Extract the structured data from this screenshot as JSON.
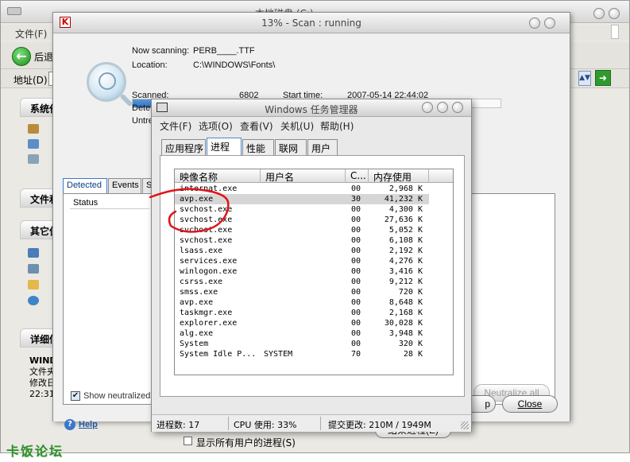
{
  "explorer": {
    "title": "本地磁盘 (C:)",
    "menu_file": "文件(F)",
    "back_label": "后退",
    "address_label": "地址(D)",
    "task_groups": [
      {
        "label": "系统任务"
      },
      {
        "label": "文件和"
      },
      {
        "label": "其它位"
      },
      {
        "label": "详细信"
      }
    ],
    "details_lines": [
      "WIND",
      "文件夹",
      "修改日",
      "22:31"
    ]
  },
  "scan": {
    "title": "13% - Scan : running",
    "now_scanning_label": "Now scanning:",
    "now_scanning_value": "PERB____.TTF",
    "location_label": "Location:",
    "location_value": "C:\\WINDOWS\\Fonts\\",
    "progress_percent": 13,
    "scanned_label": "Scanned:",
    "scanned_value": "6802",
    "start_time_label": "Start time:",
    "start_time_value": "2007-05-14 22:44:02",
    "detected_label_partial": "Dete",
    "untreated_label_partial": "Untre",
    "tabs": [
      "Detected",
      "Events",
      "S"
    ],
    "status_column": "Status",
    "show_neutralized": "Show neutralized",
    "neutralize_all": "Neutralize all",
    "help": "Help",
    "close": "Close",
    "stop_partial": "p"
  },
  "taskmgr": {
    "title": "Windows 任务管理器",
    "menu": [
      "文件(F)",
      "选项(O)",
      "查看(V)",
      "关机(U)",
      "帮助(H)"
    ],
    "tabs": [
      "应用程序",
      "进程",
      "性能",
      "联网",
      "用户"
    ],
    "active_tab": "进程",
    "columns": [
      "映像名称",
      "用户名",
      "C...",
      "内存使用"
    ],
    "processes": [
      {
        "name": "internat.exe",
        "user": "",
        "cpu": "00",
        "mem": "2,968 K"
      },
      {
        "name": "avp.exe",
        "user": "",
        "cpu": "30",
        "mem": "41,232 K"
      },
      {
        "name": "svchost.exe",
        "user": "",
        "cpu": "00",
        "mem": "4,300 K"
      },
      {
        "name": "svchost.exe",
        "user": "",
        "cpu": "00",
        "mem": "27,636 K"
      },
      {
        "name": "svchost.exe",
        "user": "",
        "cpu": "00",
        "mem": "5,052 K"
      },
      {
        "name": "svchost.exe",
        "user": "",
        "cpu": "00",
        "mem": "6,108 K"
      },
      {
        "name": "lsass.exe",
        "user": "",
        "cpu": "00",
        "mem": "2,192 K"
      },
      {
        "name": "services.exe",
        "user": "",
        "cpu": "00",
        "mem": "4,276 K"
      },
      {
        "name": "winlogon.exe",
        "user": "",
        "cpu": "00",
        "mem": "3,416 K"
      },
      {
        "name": "csrss.exe",
        "user": "",
        "cpu": "00",
        "mem": "9,212 K"
      },
      {
        "name": "smss.exe",
        "user": "",
        "cpu": "00",
        "mem": "720 K"
      },
      {
        "name": "avp.exe",
        "user": "",
        "cpu": "00",
        "mem": "8,648 K"
      },
      {
        "name": "taskmgr.exe",
        "user": "",
        "cpu": "00",
        "mem": "2,168 K"
      },
      {
        "name": "explorer.exe",
        "user": "",
        "cpu": "00",
        "mem": "30,028 K"
      },
      {
        "name": "alg.exe",
        "user": "",
        "cpu": "00",
        "mem": "3,948 K"
      },
      {
        "name": "System",
        "user": "",
        "cpu": "00",
        "mem": "320 K"
      },
      {
        "name": "System Idle P...",
        "user": "SYSTEM",
        "cpu": "70",
        "mem": "28 K"
      }
    ],
    "show_all_users": "显示所有用户的进程(S)",
    "end_process": "结束进程(E)",
    "status": {
      "processes": "进程数: 17",
      "cpu": "CPU 使用: 33%",
      "commit": "提交更改: 210M / 1949M"
    }
  },
  "watermark": "卡饭论坛",
  "colors": {
    "progress_fill": "#2e6fc0",
    "annotation": "#e0141a",
    "watermark": "#2f8b2f"
  }
}
